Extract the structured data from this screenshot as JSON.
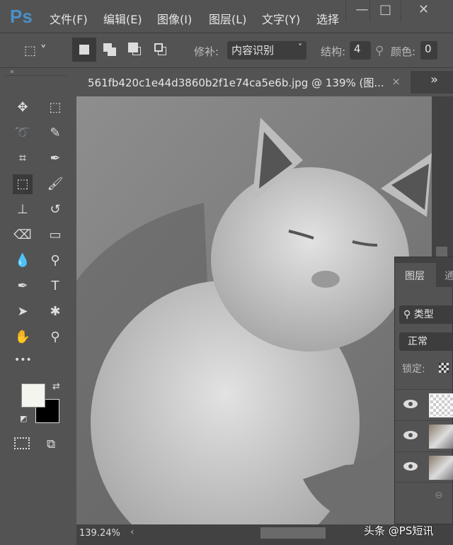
{
  "app": {
    "logo": "Ps",
    "menu": [
      "文件(F)",
      "编辑(E)",
      "图像(I)",
      "图层(L)",
      "文字(Y)",
      "选择"
    ],
    "window_buttons": [
      "—",
      "□",
      "✕"
    ]
  },
  "options": {
    "patch_label": "修补:",
    "patch_value": "内容识别",
    "structure_label": "结构:",
    "structure_value": "4",
    "color_label": "颜色:",
    "color_value": "0"
  },
  "document": {
    "tab_title": "561fb420c1e44d3860b2f1e74ca5e6b.jpg  @  139% (图...",
    "close": "×",
    "more": "»",
    "zoom": "139.24%"
  },
  "layers_panel": {
    "tabs": [
      "图层",
      "通"
    ],
    "filter": "类型",
    "blend_mode": "正常",
    "lock_label": "锁定:"
  },
  "toolbar": {
    "collapse": "«",
    "more": "•••"
  },
  "watermark": "头条 @PS短讯"
}
